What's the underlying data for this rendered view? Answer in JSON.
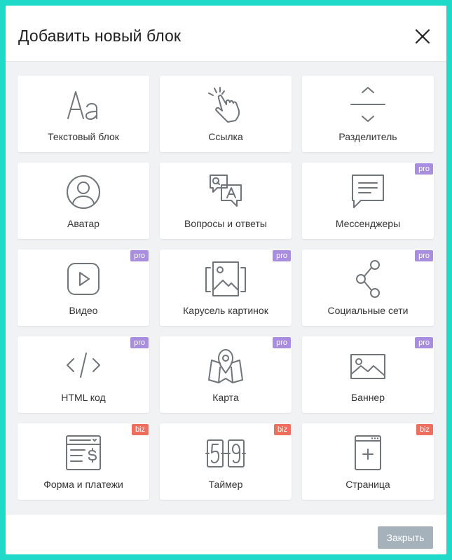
{
  "dialog": {
    "title": "Добавить новый блок",
    "close_icon": "close-icon",
    "close_button_label": "Закрыть"
  },
  "blocks": [
    {
      "label": "Текстовый блок",
      "icon": "text-icon",
      "badge": ""
    },
    {
      "label": "Ссылка",
      "icon": "pointer-hand-icon",
      "badge": ""
    },
    {
      "label": "Разделитель",
      "icon": "divider-icon",
      "badge": ""
    },
    {
      "label": "Аватар",
      "icon": "avatar-icon",
      "badge": ""
    },
    {
      "label": "Вопросы и ответы",
      "icon": "qa-icon",
      "badge": ""
    },
    {
      "label": "Мессенджеры",
      "icon": "chat-icon",
      "badge": "pro"
    },
    {
      "label": "Видео",
      "icon": "video-icon",
      "badge": "pro"
    },
    {
      "label": "Карусель картинок",
      "icon": "carousel-icon",
      "badge": "pro"
    },
    {
      "label": "Социальные сети",
      "icon": "share-icon",
      "badge": "pro"
    },
    {
      "label": "HTML код",
      "icon": "code-icon",
      "badge": "pro"
    },
    {
      "label": "Карта",
      "icon": "map-icon",
      "badge": "pro"
    },
    {
      "label": "Баннер",
      "icon": "image-icon",
      "badge": "pro"
    },
    {
      "label": "Форма и платежи",
      "icon": "form-payment-icon",
      "badge": "biz"
    },
    {
      "label": "Таймер",
      "icon": "timer-icon",
      "badge": "biz"
    },
    {
      "label": "Страница",
      "icon": "add-page-icon",
      "badge": "biz"
    }
  ],
  "colors": {
    "page_background": "#1fd9c9",
    "pro_badge": "#a98ddf",
    "biz_badge": "#ef6f5e",
    "close_button": "#a5b1bb",
    "icon_stroke": "#6f7579"
  }
}
